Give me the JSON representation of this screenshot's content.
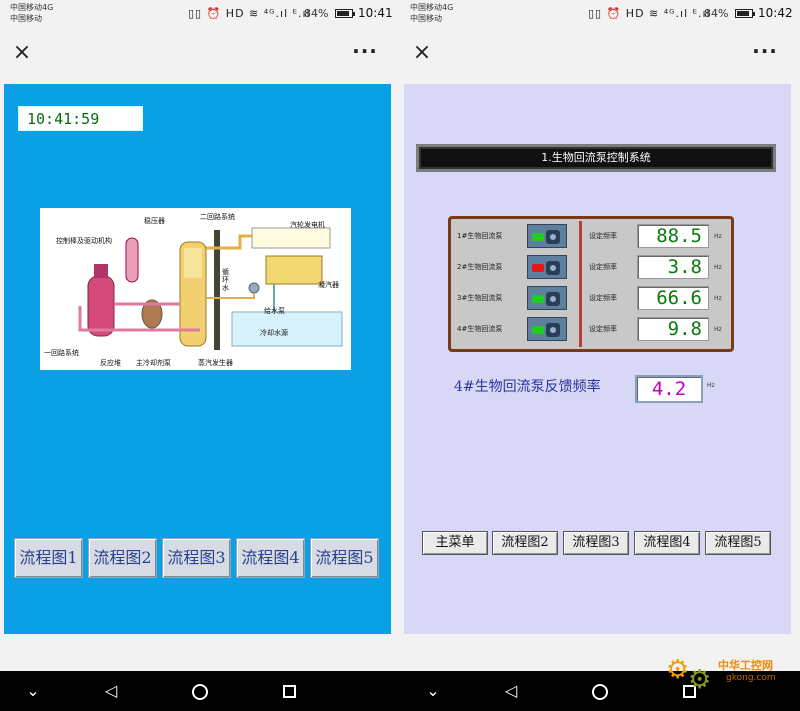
{
  "left_phone": {
    "status": {
      "carrier_line1": "中国移动4G",
      "carrier_line2": "中国移动",
      "icons": "▯▯ ⏰ HD ≋ ⁴ᴳ.ıl ᴱ.ıl",
      "battery_pct": "84%",
      "battery_level": 0.84,
      "time": "10:41"
    },
    "nav": {
      "close": "×",
      "more": "···"
    },
    "screen": {
      "clock": "10:41:59",
      "diagram_labels": {
        "stabilizer": "稳压器",
        "secondary_loop": "二回路系统",
        "turbine_generator": "汽轮发电机",
        "control_rod": "控制棒及驱动机构",
        "circulating_water": "循环水",
        "condenser": "凝汽器",
        "feed_pump": "给水泵",
        "primary_loop": "一回路系统",
        "cooling_water_pool": "冷却水源",
        "reactor": "反应堆",
        "main_coolant_pump": "主冷却剂泵",
        "steam_generator": "蒸汽发生器"
      },
      "buttons": [
        "流程图1",
        "流程图2",
        "流程图3",
        "流程图4",
        "流程图5"
      ]
    }
  },
  "right_phone": {
    "status": {
      "carrier_line1": "中国移动4G",
      "carrier_line2": "中国移动",
      "icons": "▯▯ ⏰ HD ≋ ⁴ᴳ.ıl ᴱ.ıl",
      "battery_pct": "84%",
      "battery_level": 0.84,
      "time": "10:42"
    },
    "nav": {
      "close": "×",
      "more": "···"
    },
    "screen": {
      "title": "1.生物回流泵控制系统",
      "pumps": [
        {
          "name": "1#生物回流泵",
          "status_color": "#22cc22",
          "freq_label": "设定频率",
          "freq": "88.5",
          "unit": "Hz"
        },
        {
          "name": "2#生物回流泵",
          "status_color": "#e01818",
          "freq_label": "设定频率",
          "freq": "3.8",
          "unit": "Hz"
        },
        {
          "name": "3#生物回流泵",
          "status_color": "#22cc22",
          "freq_label": "设定频率",
          "freq": "66.6",
          "unit": "Hz"
        },
        {
          "name": "4#生物回流泵",
          "status_color": "#22cc22",
          "freq_label": "设定频率",
          "freq": "9.8",
          "unit": "Hz"
        }
      ],
      "feedback": {
        "label": "4#生物回流泵反馈频率",
        "value": "4.2",
        "unit": "Hz"
      },
      "buttons": [
        "主菜单",
        "流程图2",
        "流程图3",
        "流程图4",
        "流程图5"
      ]
    }
  },
  "system_nav": {
    "back": "◁",
    "home": "○",
    "recent": "□",
    "menu": "⌄"
  },
  "watermark": {
    "line1": "中华工控网",
    "line2": "gkong.com"
  }
}
